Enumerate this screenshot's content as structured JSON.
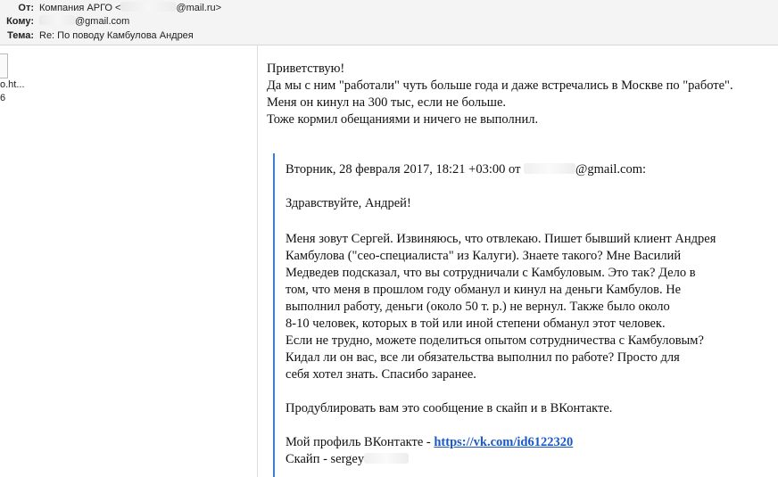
{
  "header": {
    "from_label": "От:",
    "from_value_prefix": "Компания АРГО <",
    "from_value_suffix": "@mail.ru>",
    "to_label": "Кому:",
    "to_value_suffix": "@gmail.com",
    "subject_label": "Тема:",
    "subject_value": "Re: По поводу Камбулова Андрея"
  },
  "attachment": {
    "name": "o.ht...",
    "size": "6"
  },
  "reply": {
    "lines": [
      "Приветствую!",
      "Да мы с ним \"работали\" чуть больше года и даже встречались в Москве по \"работе\".",
      "Меня он кинул на 300 тыс, если не больше.",
      "Тоже кормил обещаниями и ничего не выполнил."
    ]
  },
  "quoted": {
    "date_line_prefix": "Вторник, 28 февраля 2017, 18:21 +03:00 от ",
    "date_line_suffix": "@gmail.com:",
    "greeting": "Здравствуйте, Андрей!",
    "body_lines": [
      "Меня зовут Сергей. Извиняюсь, что отвлекаю. Пишет бывший клиент Андрея",
      "Камбулова (\"сео-специалиста\" из Калуги). Знаете такого? Мне Василий",
      "Медведев подсказал, что вы сотрудничали с Камбуловым. Это так? Дело в",
      "том, что меня в прошлом году обманул и кинул на деньги Камбулов. Не",
      "выполнил работу, деньги (около 50 т. р.) не вернул. Также было около",
      "8-10 человек, которых в той или иной степени обманул этот человек.",
      "Если не трудно, можете поделиться опытом сотрудничества с Камбуловым?",
      "Кидал ли он вас, все ли обязательства выполнил по работе? Просто для",
      "себя хотел знать. Спасибо заранее."
    ],
    "duplicate_line": "Продублировать вам это сообщение в скайп и в ВКонтакте.",
    "vk_label": "Мой профиль ВКонтакте - ",
    "vk_link": "https://vk.com/id6122320",
    "skype_label": "Скайп - sergey"
  }
}
